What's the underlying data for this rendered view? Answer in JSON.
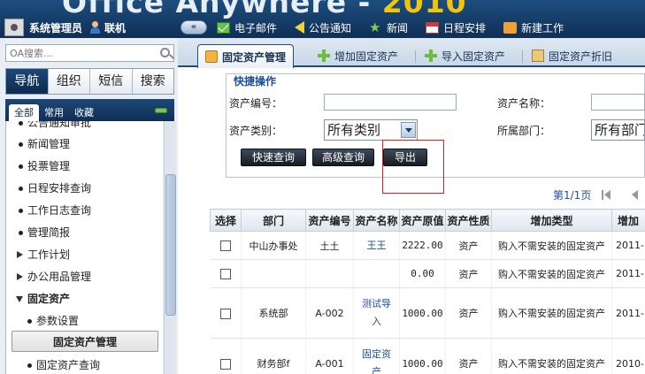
{
  "header": {
    "brand_text": "Office Anywhere",
    "brand_year": "2010",
    "user_name": "系统管理员",
    "user_status": "联机",
    "collapse_label": "«",
    "shortcuts": [
      {
        "label": "电子邮件",
        "icon": "mail-icon"
      },
      {
        "label": "公告通知",
        "icon": "notice-icon"
      },
      {
        "label": "新闻",
        "icon": "news-icon"
      },
      {
        "label": "日程安排",
        "icon": "calendar-icon"
      },
      {
        "label": "新建工作",
        "icon": "new-work-icon"
      }
    ]
  },
  "sidebar": {
    "search_placeholder": "OA搜索...",
    "tabs": [
      "导航",
      "组织",
      "短信",
      "搜索"
    ],
    "active_tab": "导航",
    "subtabs": [
      "全部",
      "常用",
      "收藏"
    ],
    "menu": [
      {
        "label": "公告通知审批",
        "kind": "dot"
      },
      {
        "label": "新闻管理",
        "kind": "dot"
      },
      {
        "label": "投票管理",
        "kind": "dot"
      },
      {
        "label": "日程安排查询",
        "kind": "dot"
      },
      {
        "label": "工作日志查询",
        "kind": "dot"
      },
      {
        "label": "管理简报",
        "kind": "dot"
      },
      {
        "label": "工作计划",
        "kind": "collapsed"
      },
      {
        "label": "办公用品管理",
        "kind": "collapsed"
      },
      {
        "label": "固定资产",
        "kind": "expanded"
      },
      {
        "label": "参数设置",
        "kind": "subdot"
      },
      {
        "label": "固定资产管理",
        "kind": "selected"
      },
      {
        "label": "固定资产查询",
        "kind": "subdot"
      }
    ]
  },
  "tabs": [
    {
      "label": "固定资产管理",
      "icon": "asset-icon",
      "active": true
    },
    {
      "label": "增加固定资产",
      "icon": "plus-icon"
    },
    {
      "label": "导入固定资产",
      "icon": "plus-icon"
    },
    {
      "label": "固定资产折旧",
      "icon": "folder-icon"
    }
  ],
  "quick": {
    "title": "快捷操作",
    "asset_no_label": "资产编号：",
    "asset_name_label": "资产名称：",
    "asset_type_label": "资产类别：",
    "asset_type_value": "所有类别",
    "dept_label": "所属部门：",
    "dept_value": "所有部门",
    "btn_quick": "快速查询",
    "btn_advanced": "高级查询",
    "btn_export": "导出"
  },
  "pager": {
    "info": "第1/1页"
  },
  "table": {
    "headers": [
      "选择",
      "部门",
      "资产编号",
      "资产名称",
      "资产原值",
      "资产性质",
      "增加类型",
      "增加"
    ],
    "rows": [
      [
        "",
        "中山办事处",
        "土土",
        "王王",
        "2222.00",
        "资产",
        "购入不需安装的固定资产",
        "2011-"
      ],
      [
        "",
        "",
        "",
        "",
        "0.00",
        "资产",
        "购入不需安装的固定资产",
        "2011-"
      ],
      [
        "",
        "系统部",
        "A-002",
        "测试导入",
        "1000.00",
        "资产",
        "购入不需安装的固定资产",
        "2011-"
      ],
      [
        "",
        "财务部f",
        "A-001",
        "固定资产",
        "1000.00",
        "资产",
        "购入不需安装的固定资产",
        "2010-"
      ]
    ]
  }
}
